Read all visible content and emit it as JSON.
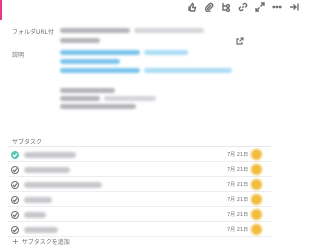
{
  "toolbar": {
    "icons": [
      "thumbs-up-icon",
      "attachment-icon",
      "subtasks-icon",
      "link-icon",
      "expand-icon",
      "more-icon",
      "close-panel-icon"
    ]
  },
  "fields": {
    "folder_url_label": "フォルダURL付",
    "description_label": "説明"
  },
  "subtasks": {
    "title": "サブタスク",
    "items": [
      {
        "due": "7月 21日",
        "completed": true
      },
      {
        "due": "7月 21日",
        "completed": false
      },
      {
        "due": "7月 21日",
        "completed": false
      },
      {
        "due": "7月 21日",
        "completed": false
      },
      {
        "due": "7月 21日",
        "completed": false
      },
      {
        "due": "7月 21日",
        "completed": false
      }
    ],
    "add_label": "サブタスクを追加"
  },
  "colors": {
    "accent_pink": "#e53888",
    "complete_teal": "#58c7b3",
    "assignee_yellow": "#f2bd3e"
  }
}
